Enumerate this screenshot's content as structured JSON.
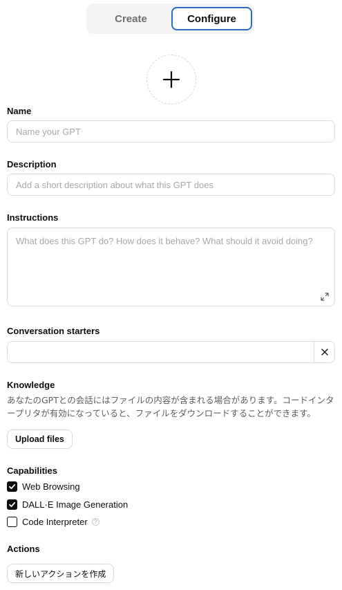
{
  "tabs": {
    "create": "Create",
    "configure": "Configure"
  },
  "avatar": {
    "icon": "plus-icon"
  },
  "fields": {
    "name": {
      "label": "Name",
      "placeholder": "Name your GPT",
      "value": ""
    },
    "description": {
      "label": "Description",
      "placeholder": "Add a short description about what this GPT does",
      "value": ""
    },
    "instructions": {
      "label": "Instructions",
      "placeholder": "What does this GPT do? How does it behave? What should it avoid doing?",
      "value": ""
    }
  },
  "conversation_starters": {
    "label": "Conversation starters",
    "value": "",
    "clear_icon": "close-icon"
  },
  "knowledge": {
    "label": "Knowledge",
    "description": "あなたのGPTとの会話にはファイルの内容が含まれる場合があります。コードインタープリタが有効になっていると、ファイルをダウンロードすることができます。",
    "upload_label": "Upload files"
  },
  "capabilities": {
    "label": "Capabilities",
    "items": [
      {
        "label": "Web Browsing",
        "checked": true
      },
      {
        "label": "DALL·E Image Generation",
        "checked": true
      },
      {
        "label": "Code Interpreter",
        "checked": false,
        "help": "?"
      }
    ]
  },
  "actions": {
    "label": "Actions",
    "button_label": "新しいアクションを作成"
  }
}
